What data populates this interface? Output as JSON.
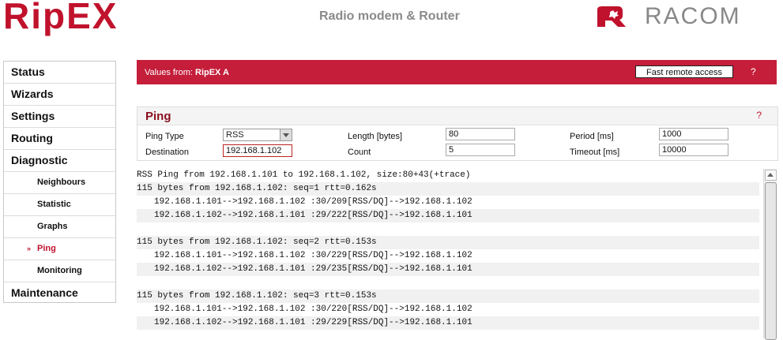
{
  "header": {
    "logo_text": "RipEX",
    "title": "Radio modem & Router",
    "brand": "RACOM",
    "brand_color": "#c0122c"
  },
  "sidebar": {
    "items": [
      {
        "label": "Status"
      },
      {
        "label": "Wizards"
      },
      {
        "label": "Settings"
      },
      {
        "label": "Routing"
      },
      {
        "label": "Diagnostic"
      },
      {
        "label": "Neighbours"
      },
      {
        "label": "Statistic"
      },
      {
        "label": "Graphs"
      },
      {
        "label": "Ping"
      },
      {
        "label": "Monitoring"
      },
      {
        "label": "Maintenance"
      }
    ],
    "active_arrow": "»"
  },
  "banner": {
    "prefix": "Values from:",
    "device": "RipEX A",
    "fast_access_label": "Fast remote access",
    "help": "?",
    "color": "#c41e3a"
  },
  "ping": {
    "title": "Ping",
    "help": "?",
    "type_label": "Ping Type",
    "type_value": "RSS",
    "destination_label": "Destination",
    "destination_value": "192.168.1.102",
    "length_label": "Length [bytes]",
    "length_value": "80",
    "count_label": "Count",
    "count_value": "5",
    "period_label": "Period [ms]",
    "period_value": "1000",
    "timeout_label": "Timeout [ms]",
    "timeout_value": "10000"
  },
  "output": {
    "lines": [
      "RSS Ping from 192.168.1.101 to 192.168.1.102, size:80+43(+trace)",
      "115 bytes from 192.168.1.102: seq=1 rtt=0.162s",
      "192.168.1.101-->192.168.1.102 :30/209[RSS/DQ]-->192.168.1.102",
      "192.168.1.102-->192.168.1.101 :29/222[RSS/DQ]-->192.168.1.101",
      "",
      "115 bytes from 192.168.1.102: seq=2 rtt=0.153s",
      "192.168.1.101-->192.168.1.102 :30/229[RSS/DQ]-->192.168.1.102",
      "192.168.1.102-->192.168.1.101 :29/235[RSS/DQ]-->192.168.1.101",
      "",
      "115 bytes from 192.168.1.102: seq=3 rtt=0.153s",
      "192.168.1.101-->192.168.1.102 :30/220[RSS/DQ]-->192.168.1.102",
      "192.168.1.102-->192.168.1.101 :29/229[RSS/DQ]-->192.168.1.101"
    ]
  }
}
